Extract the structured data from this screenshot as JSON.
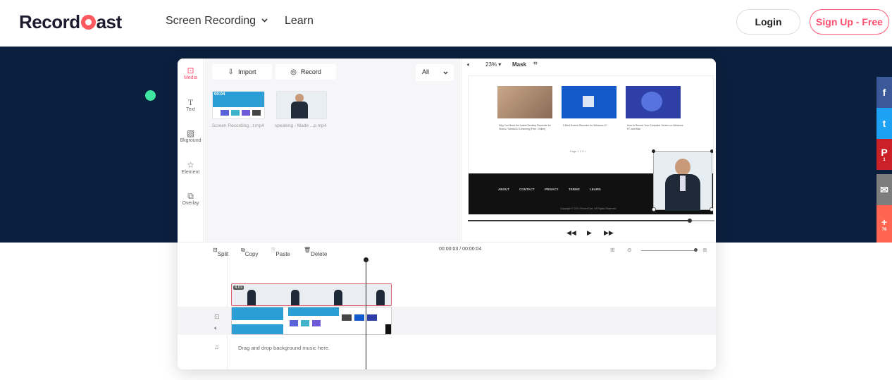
{
  "nav": {
    "logo_prefix": "Record",
    "logo_suffix": "ast",
    "menu_recording": "Screen Recording",
    "menu_learn": "Learn",
    "login": "Login",
    "signup": "Sign Up - Free"
  },
  "sidebar": {
    "items": [
      {
        "label": "Media",
        "icon": "media-icon"
      },
      {
        "label": "Text",
        "icon": "text-icon"
      },
      {
        "label": "Bkground",
        "icon": "background-icon"
      },
      {
        "label": "Element",
        "icon": "star-icon"
      },
      {
        "label": "Overlay",
        "icon": "overlay-icon"
      }
    ]
  },
  "media": {
    "import": "Import",
    "record": "Record",
    "filter": "All",
    "files": [
      {
        "name": "Screen Recording...t.mp4",
        "badge": "00:04"
      },
      {
        "name": "speaking - Made ...p.mp4"
      }
    ]
  },
  "preview": {
    "zoom": "23%",
    "mask": "Mask",
    "cards": [
      {
        "caption": "Why You Need the Latest Desktop Recorder for How-to Tutorial & E-learning (Free, Online)"
      },
      {
        "caption": "5 Best Screen Recorder for Windows 10"
      },
      {
        "caption": "How to Record Your Computer Screen on Windows PC and Mac"
      }
    ],
    "pagination": "Page  1  2  3  »",
    "footer_links": [
      "ABOUT",
      "CONTACT",
      "PRIVACY",
      "TERMS",
      "LEARN"
    ],
    "copyright": "Copyright © 2021 RecordCast. All Rights Reserved."
  },
  "toolbar": {
    "split": "Split",
    "copy": "Copy",
    "paste": "Paste",
    "delete": "Delete",
    "time": "00:00:03 / 00:00:04"
  },
  "timeline": {
    "clip_duration": "4.0s",
    "music_hint": "Drag and drop background music here.",
    "progress_fraction": 0.9
  },
  "share": {
    "colors": [
      "#3b5998",
      "#1da1f2",
      "#cb2027",
      "#7d7d7d",
      "#ff6550"
    ],
    "counts": [
      "1",
      "76"
    ]
  },
  "colors": {
    "accent": "#ff4d6d",
    "hero": "#0b1f3e",
    "green_dot": "#3ee6a0"
  }
}
